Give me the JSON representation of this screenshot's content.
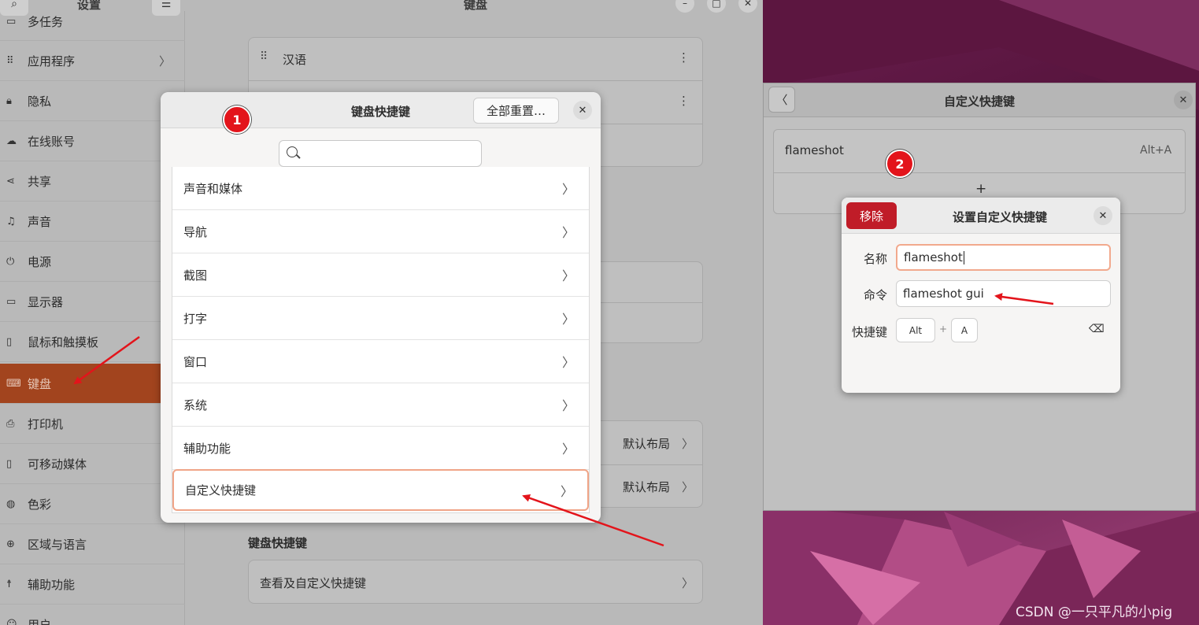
{
  "settings": {
    "title": "设置",
    "page_title": "键盘",
    "sidebar": {
      "items": [
        {
          "label": "多任务",
          "icon": "multitasking-icon"
        },
        {
          "label": "应用程序",
          "icon": "apps-icon"
        },
        {
          "label": "隐私",
          "icon": "lock-icon"
        },
        {
          "label": "在线账号",
          "icon": "cloud-icon"
        },
        {
          "label": "共享",
          "icon": "share-icon"
        },
        {
          "label": "声音",
          "icon": "music-note-icon"
        },
        {
          "label": "电源",
          "icon": "power-icon"
        },
        {
          "label": "显示器",
          "icon": "display-icon"
        },
        {
          "label": "鼠标和触摸板",
          "icon": "mouse-icon"
        },
        {
          "label": "键盘",
          "icon": "keyboard-icon",
          "active": true
        },
        {
          "label": "打印机",
          "icon": "printer-icon"
        },
        {
          "label": "可移动媒体",
          "icon": "removable-media-icon"
        },
        {
          "label": "色彩",
          "icon": "color-icon"
        },
        {
          "label": "区域与语言",
          "icon": "globe-icon"
        },
        {
          "label": "辅助功能",
          "icon": "accessibility-icon"
        },
        {
          "label": "用户",
          "icon": "user-icon"
        }
      ]
    },
    "main": {
      "input_language": "汉语",
      "layout_value_1": "默认布局",
      "layout_value_2": "默认布局",
      "shortcuts_section": "键盘快捷键",
      "view_shortcuts": "查看及自定义快捷键"
    }
  },
  "ks_modal": {
    "title": "键盘快捷键",
    "reset_label": "全部重置…",
    "categories": [
      "声音和媒体",
      "导航",
      "截图",
      "打字",
      "窗口",
      "系统",
      "辅助功能",
      "自定义快捷键"
    ]
  },
  "cs_window": {
    "title": "自定义快捷键",
    "entry_name": "flameshot",
    "entry_accel": "Alt+A",
    "add_label": "+"
  },
  "set_dialog": {
    "title": "设置自定义快捷键",
    "remove_label": "移除",
    "name_label": "名称",
    "name_value": "flameshot",
    "command_label": "命令",
    "command_value": "flameshot gui",
    "shortcut_label": "快捷键",
    "key_1": "Alt",
    "plus": "+",
    "key_2": "A",
    "backspace_glyph": "⌫"
  },
  "annotations": {
    "badge_1": "1",
    "badge_2": "2",
    "arrow_color": "#e3141b"
  },
  "watermark": "CSDN @一只平凡的小pig",
  "colors": {
    "accent": "#a2441e",
    "destructive": "#c01c28",
    "focus_ring": "#f2a98d"
  }
}
